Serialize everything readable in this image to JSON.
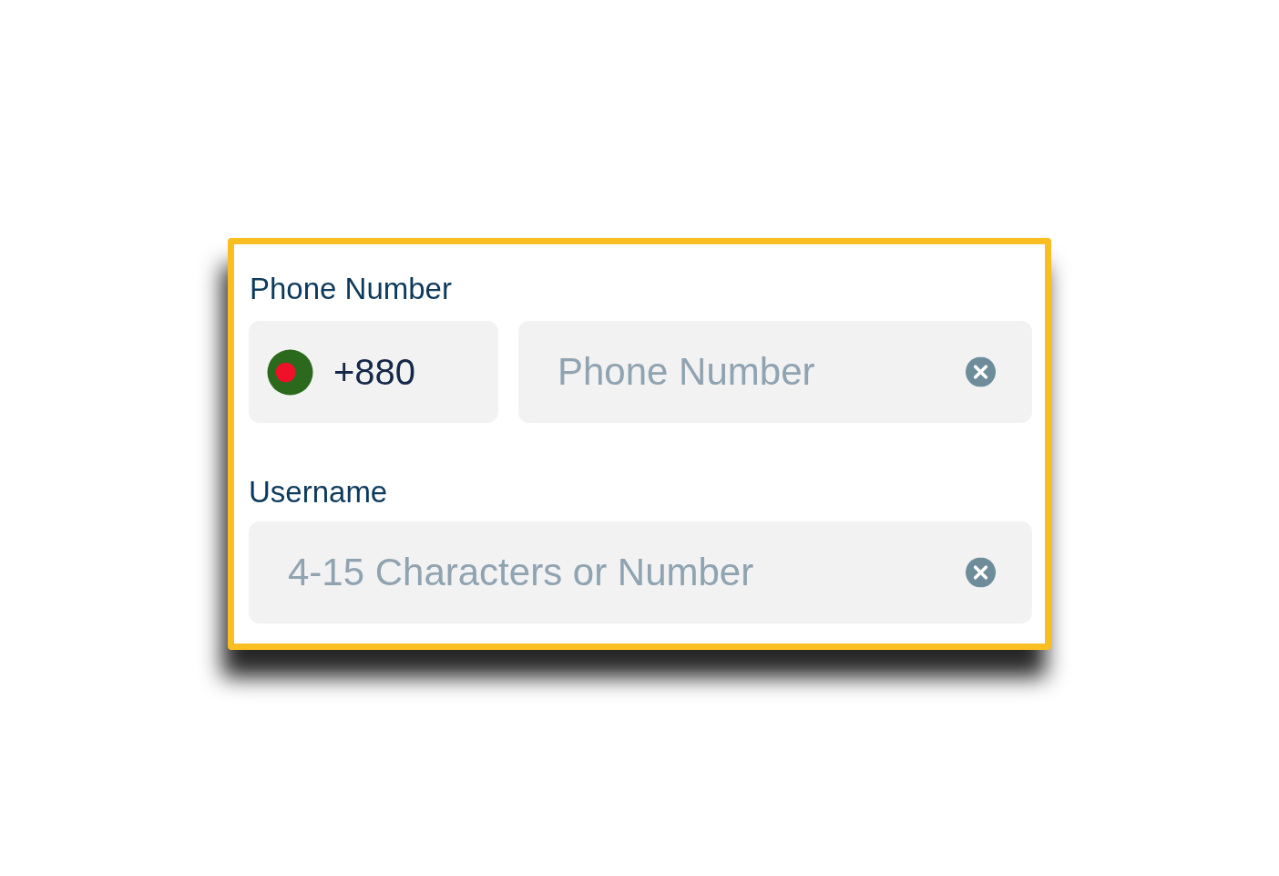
{
  "form": {
    "fields": [
      {
        "kind": "phone",
        "label": "Phone Number",
        "country_code": "+880",
        "placeholder": "Phone Number"
      },
      {
        "kind": "text",
        "label": "Username",
        "placeholder": "4-15 Characters or Number"
      }
    ]
  }
}
